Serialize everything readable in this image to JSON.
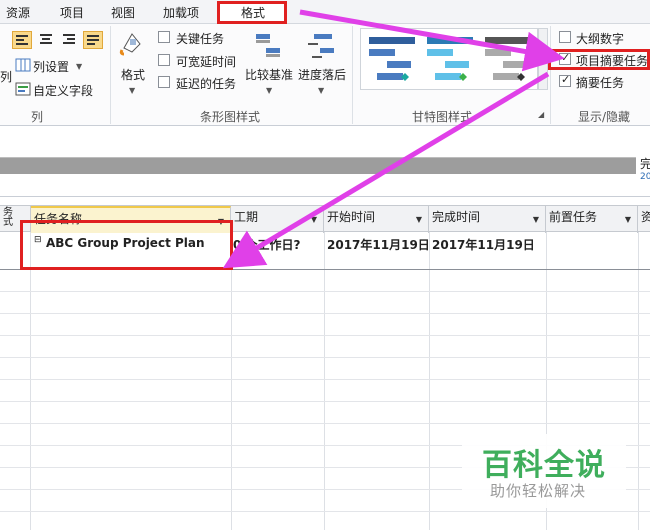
{
  "menu": {
    "tabs": [
      "资源",
      "项目",
      "视图",
      "加载项"
    ],
    "active_tab": "格式"
  },
  "ribbon": {
    "columns_group": {
      "label": "列",
      "partial_left": "列",
      "format_button": "格式",
      "column_settings": "列设置",
      "custom_fields": "自定义字段"
    },
    "bar_styles_group": {
      "label": "条形图样式",
      "critical_tasks": "关键任务",
      "slack": "可宽延时间",
      "late_tasks": "延迟的任务",
      "baseline": "比较基准",
      "slippage": "进度落后"
    },
    "gantt_styles_group": {
      "label": "甘特图样式"
    },
    "show_hide_group": {
      "label": "显示/隐藏",
      "outline_number": {
        "label": "大纲数字",
        "checked": false
      },
      "project_summary_task": {
        "label": "项目摘要任务",
        "checked": true
      },
      "summary_tasks": {
        "label": "摘要任务",
        "checked": true
      }
    }
  },
  "timeline": {
    "finish_label": "完",
    "finish_year": "20"
  },
  "grid": {
    "headers": {
      "indicator": "务\n式",
      "task_name": "任务名称",
      "duration": "工期",
      "start": "开始时间",
      "finish": "完成时间",
      "predecessors": "前置任务",
      "resources": "资"
    },
    "rows": [
      {
        "collapse": "⊟",
        "task_name": "ABC Group Project Plan",
        "duration": "0 个工作日?",
        "start": "2017年11月19日",
        "finish": "2017年11月19日",
        "predecessors": ""
      }
    ]
  },
  "watermark": {
    "title": "百科全说",
    "subtitle": "助你轻松解决"
  },
  "colors": {
    "highlight_box": "#e02020",
    "arrow": "#e040e8",
    "accent_header": "#fbf3cf"
  }
}
